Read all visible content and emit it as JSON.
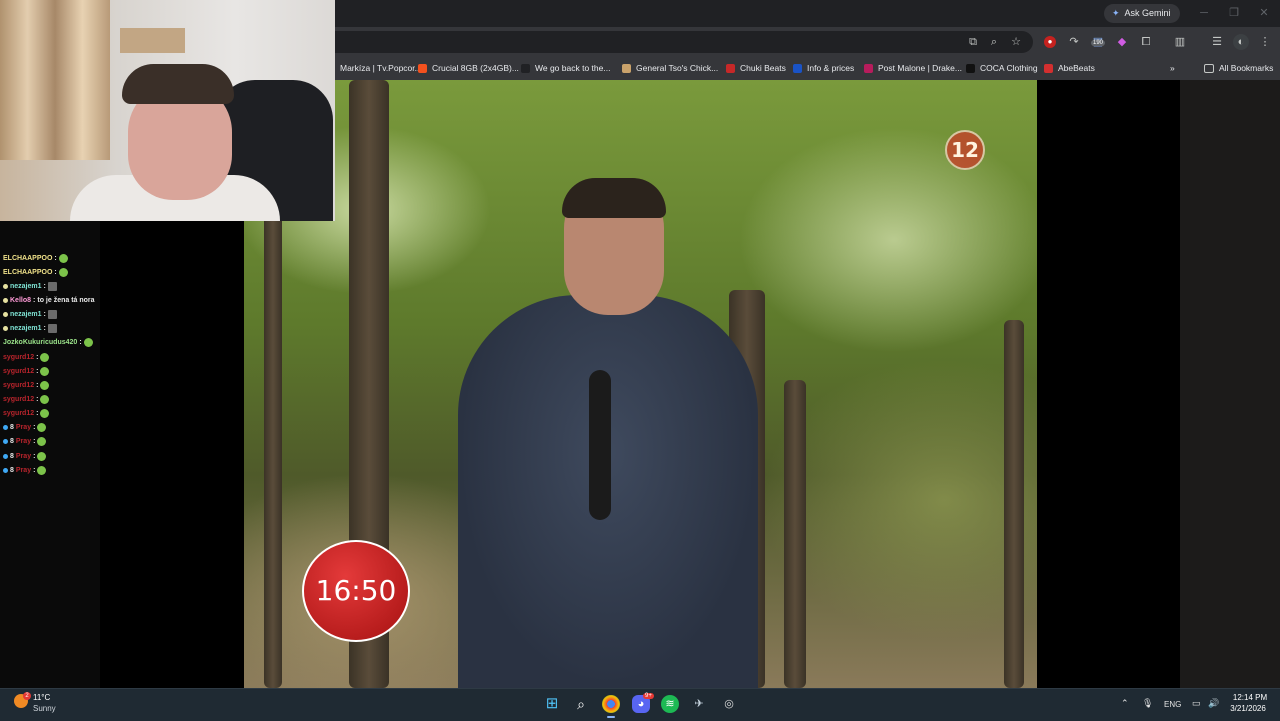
{
  "browser": {
    "ask_gemini": "Ask Gemini",
    "bookmarks": [
      {
        "label": "Markíza | Tv.Popcor...",
        "icon": "markiza-favicon",
        "color": "#35363a"
      },
      {
        "label": "Crucial 8GB (2x4GB)...",
        "icon": "crucial-favicon",
        "color": "#f4511e"
      },
      {
        "label": "We go back to the...",
        "icon": "genius-favicon",
        "color": "#202124"
      },
      {
        "label": "General Tso's Chick...",
        "icon": "recipe-favicon",
        "color": "#c9a26b"
      },
      {
        "label": "Chuki Beats",
        "icon": "chuki-favicon",
        "color": "#c62828"
      },
      {
        "label": "Info & prices",
        "icon": "b-favicon",
        "color": "#1a53c6"
      },
      {
        "label": "Post Malone | Drake...",
        "icon": "twitch-favicon",
        "color": "#b71c5c"
      },
      {
        "label": "COCA Clothing",
        "icon": "coca-favicon",
        "color": "#111111"
      },
      {
        "label": "AbeBeats",
        "icon": "abebeats-favicon",
        "color": "#d32f2f"
      }
    ],
    "all_bookmarks": "All Bookmarks",
    "ext_badge": "190"
  },
  "video": {
    "channel_logo": "12",
    "clock_time": "16:50"
  },
  "chat": [
    {
      "user": "ELCHAAPPOO",
      "sep": ":",
      "msg": "",
      "user_class": "u-yellow",
      "badge": "",
      "emote": "round"
    },
    {
      "user": "ELCHAAPPOO",
      "sep": ":",
      "msg": "",
      "user_class": "u-yellow",
      "badge": "",
      "emote": "round"
    },
    {
      "user": "nezajem1",
      "sep": ":",
      "msg": "",
      "user_class": "u-cyan",
      "badge": "#e6e1a0",
      "emote": "square"
    },
    {
      "user": "Kello8",
      "sep": ":",
      "msg": "to je žena tá nora",
      "user_class": "u-pink",
      "badge": "#e6e1a0",
      "emote": ""
    },
    {
      "user": "nezajem1",
      "sep": ":",
      "msg": "",
      "user_class": "u-cyan",
      "badge": "#e6e1a0",
      "emote": "square"
    },
    {
      "user": "nezajem1",
      "sep": ":",
      "msg": "",
      "user_class": "u-cyan",
      "badge": "#e6e1a0",
      "emote": "square"
    },
    {
      "user": "JozkoKukuricudus420",
      "sep": ":",
      "msg": "",
      "user_class": "u-green",
      "badge": "",
      "emote": "round"
    },
    {
      "user": "sygurd12",
      "sep": ":",
      "msg": "",
      "user_class": "u-red",
      "badge": "",
      "emote": "round"
    },
    {
      "user": "sygurd12",
      "sep": ":",
      "msg": "",
      "user_class": "u-red",
      "badge": "",
      "emote": "round"
    },
    {
      "user": "sygurd12",
      "sep": ":",
      "msg": "",
      "user_class": "u-red",
      "badge": "",
      "emote": "round"
    },
    {
      "user": "sygurd12",
      "sep": ":",
      "msg": "",
      "user_class": "u-red",
      "badge": "",
      "emote": "round"
    },
    {
      "user": "sygurd12",
      "sep": ":",
      "msg": "",
      "user_class": "u-red",
      "badge": "",
      "emote": "round"
    },
    {
      "user": "Pray",
      "sep": ":",
      "msg": "",
      "user_class": "u-red",
      "badge": "#3fa9f5",
      "prefix": "8",
      "emote": "round"
    },
    {
      "user": "Pray",
      "sep": ":",
      "msg": "",
      "user_class": "u-red",
      "badge": "#3fa9f5",
      "prefix": "8",
      "emote": "round"
    },
    {
      "user": "Pray",
      "sep": ":",
      "msg": "",
      "user_class": "u-red",
      "badge": "#3fa9f5",
      "prefix": "8",
      "emote": "round"
    },
    {
      "user": "Pray",
      "sep": ":",
      "msg": "",
      "user_class": "u-red",
      "badge": "#3fa9f5",
      "prefix": "8",
      "emote": "round"
    }
  ],
  "taskbar": {
    "temperature": "11°C",
    "weather": "Sunny",
    "weather_alert": "2",
    "language": "ENG",
    "time": "12:14 PM",
    "date": "3/21/2026",
    "discord_badge": "9+"
  }
}
